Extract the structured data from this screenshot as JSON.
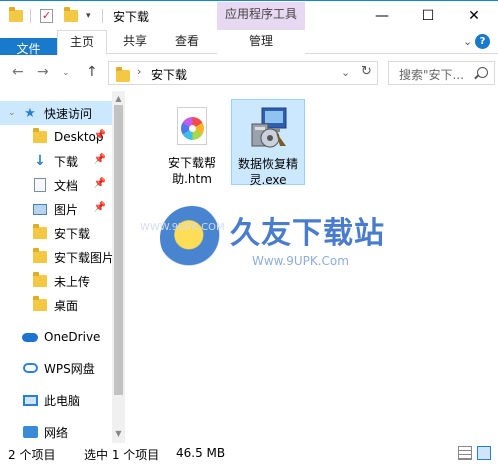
{
  "window": {
    "title": "安下载",
    "context_tab": "应用程序工具",
    "controls": [
      "—",
      "☐",
      "✕"
    ]
  },
  "ribbon": {
    "tabs": [
      {
        "label": "文件"
      },
      {
        "label": "主页"
      },
      {
        "label": "共享"
      },
      {
        "label": "查看"
      },
      {
        "label": "管理"
      }
    ]
  },
  "address": {
    "path": "安下载",
    "search_placeholder": "搜索\"安下..."
  },
  "nav": {
    "quick_access": "快速访问",
    "items": [
      {
        "label": "Desktop",
        "icon": "folder-icon",
        "pinned": true
      },
      {
        "label": "下载",
        "icon": "download-icon",
        "pinned": true
      },
      {
        "label": "文档",
        "icon": "document-icon",
        "pinned": true
      },
      {
        "label": "图片",
        "icon": "picture-icon",
        "pinned": true
      },
      {
        "label": "安下载",
        "icon": "folder-icon",
        "pinned": false
      },
      {
        "label": "安下载图片",
        "icon": "folder-icon",
        "pinned": false
      },
      {
        "label": "未上传",
        "icon": "folder-icon",
        "pinned": false
      },
      {
        "label": "桌面",
        "icon": "folder-icon",
        "pinned": false
      }
    ],
    "onedrive": "OneDrive",
    "wps": "WPS网盘",
    "this_pc": "此电脑",
    "network": "网络"
  },
  "files": [
    {
      "name": "安下载帮助.htm",
      "line1": "安下载帮",
      "line2": "助.htm",
      "icon": "htm-file-icon",
      "selected": false
    },
    {
      "name": "数据恢复精灵.exe",
      "line1": "数据恢复精",
      "line2": "灵.exe",
      "icon": "installer-icon",
      "selected": true
    }
  ],
  "watermark": {
    "title": "久友下载站",
    "sub": "Www.9UPK.Com",
    "small": "WWW.9UPK.COM"
  },
  "status": {
    "count": "2 个项目",
    "selection": "选中 1 个项目",
    "size": "46.5 MB"
  }
}
